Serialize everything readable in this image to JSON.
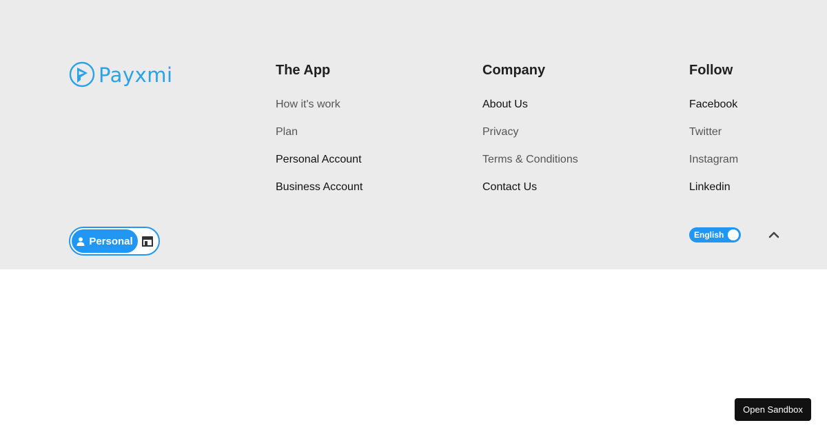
{
  "brand": {
    "name": "Payxmi",
    "color": "#2aa2e5",
    "icon": "payxmi-logo-icon"
  },
  "columns": [
    {
      "title": "The App",
      "links": [
        {
          "label": "How it's work"
        },
        {
          "label": "Plan"
        },
        {
          "label": "Personal Account"
        },
        {
          "label": "Business Account"
        }
      ]
    },
    {
      "title": "Company",
      "links": [
        {
          "label": "About Us"
        },
        {
          "label": "Privacy"
        },
        {
          "label": "Terms & Conditions"
        },
        {
          "label": "Contact Us"
        }
      ]
    },
    {
      "title": "Follow",
      "links": [
        {
          "label": "Facebook"
        },
        {
          "label": "Twitter"
        },
        {
          "label": "Instagram"
        },
        {
          "label": "Linkedin"
        }
      ]
    }
  ],
  "account_toggle": {
    "selected_label": "Personal",
    "selected_icon": "user-icon",
    "other_icon": "store-icon",
    "accent": "#2196f3"
  },
  "language_toggle": {
    "label": "English"
  },
  "scroll_top": {
    "icon": "chevron-up-icon"
  },
  "sandbox": {
    "label": "Open Sandbox"
  },
  "colors": {
    "footer_bg": "#ebebeb",
    "accent": "#2196f3",
    "heading": "#1f1f1f"
  }
}
